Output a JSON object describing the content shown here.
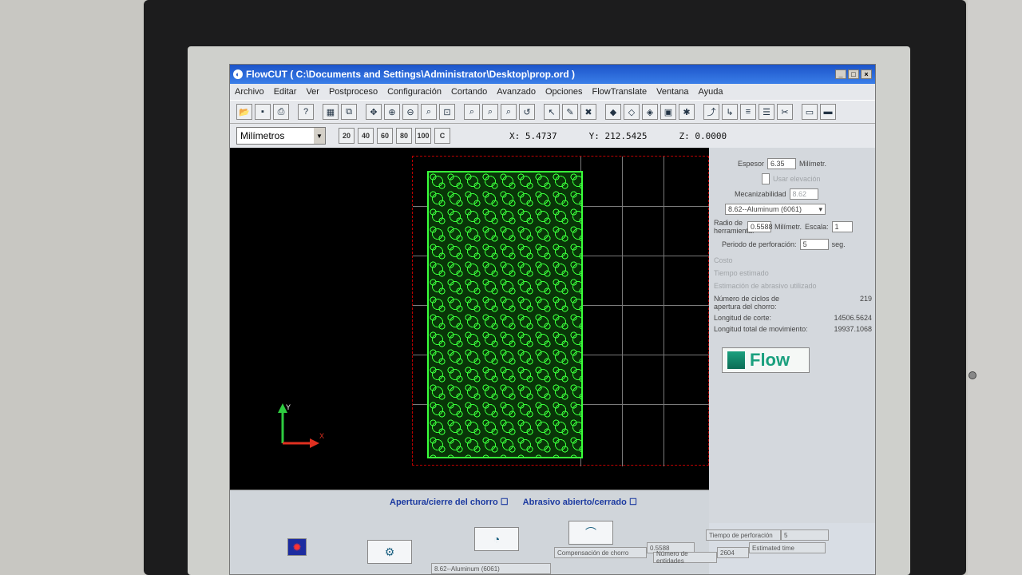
{
  "window": {
    "title": "FlowCUT ( C:\\Documents and Settings\\Administrator\\Desktop\\prop.ord )",
    "controls": [
      "_",
      "□",
      "×"
    ]
  },
  "menu": [
    "Archivo",
    "Editar",
    "Ver",
    "Postproceso",
    "Configuración",
    "Cortando",
    "Avanzado",
    "Opciones",
    "FlowTranslate",
    "Ventana",
    "Ayuda"
  ],
  "toolbar2": {
    "units": "Milímetros",
    "zoom_buttons": [
      "20",
      "40",
      "60",
      "80",
      "100",
      "C"
    ]
  },
  "coords": {
    "x": "X: 5.4737",
    "y": "Y: 212.5425",
    "z": "Z: 0.0000"
  },
  "axis": {
    "x": "X",
    "y": "Y"
  },
  "side": {
    "espesor_label": "Espesor",
    "espesor_value": "6.35",
    "espesor_unit": "Milímetr.",
    "usar_elevacion": "Usar elevación",
    "maquinabilidad_label": "Mecanizabilidad",
    "maquinabilidad_value": "8.62",
    "material": "8.62--Aluminum (6061)",
    "radio_label": "Radio de herramienta:",
    "radio_value": "0.5588",
    "radio_unit": "Milímetr.",
    "escala_label": "Escala:",
    "escala_value": "1",
    "periodo_label": "Periodo de perforación:",
    "periodo_value": "5",
    "periodo_unit": "seg.",
    "costo": "Costo",
    "tiempo_estimado": "Tiempo estimado",
    "estimacion": "Estimación de abrasivo utilizado",
    "ciclos_label": "Número de ciclos de apertura del chorro:",
    "ciclos_value": "219",
    "longitud_corte_label": "Longitud de corte:",
    "longitud_corte_value": "14506.5624",
    "longitud_total_label": "Longitud total de movimiento:",
    "longitud_total_value": "19937.1068",
    "logo": "Flow"
  },
  "bottom": {
    "apertura": "Apertura/cierre del chorro",
    "abrasivo": "Abrasivo abierto/cerrado"
  },
  "status": {
    "tiempo_perforacion_label": "Tiempo de perforación",
    "tiempo_perforacion_value": "5",
    "compensacion_label": "Compensación de chorro",
    "compensacion_value": "0.5588",
    "entidades_label": "Número de entidades",
    "entidades_value": "2604",
    "estimated_time": "Estimated time",
    "material": "8.62--Aluminum (6061)"
  }
}
